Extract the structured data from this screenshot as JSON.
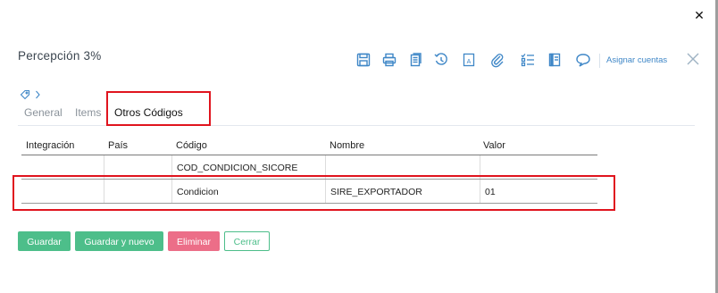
{
  "modal": {
    "title": "Percepción 3%",
    "assign_link": "Asignar cuentas"
  },
  "toolbar_icons": [
    "save-icon",
    "print-icon",
    "copy-icon",
    "history-icon",
    "text-document-icon",
    "attach-icon",
    "checklist-icon",
    "notebook-icon",
    "comment-icon",
    "close-icon"
  ],
  "tabs": [
    {
      "label": "General",
      "active": false
    },
    {
      "label": "Items",
      "active": false
    },
    {
      "label": "Otros Códigos",
      "active": true
    }
  ],
  "table": {
    "columns": [
      "Integración",
      "País",
      "Código",
      "Nombre",
      "Valor"
    ],
    "rows": [
      {
        "integracion": "",
        "pais": "",
        "codigo": "COD_CONDICION_SICORE",
        "nombre": "",
        "valor": ""
      },
      {
        "integracion": "",
        "pais": "",
        "codigo": "Condicion",
        "nombre": "SIRE_EXPORTADOR",
        "valor": "01"
      }
    ]
  },
  "buttons": {
    "save": "Guardar",
    "save_new": "Guardar y nuevo",
    "delete": "Eliminar",
    "close": "Cerrar"
  },
  "colors": {
    "accent_green": "#4dbe8a",
    "danger_pink": "#ec6e88",
    "link_blue": "#3f87c7",
    "icon_blue": "#3f87c7",
    "annotation_red": "#e0141e"
  }
}
